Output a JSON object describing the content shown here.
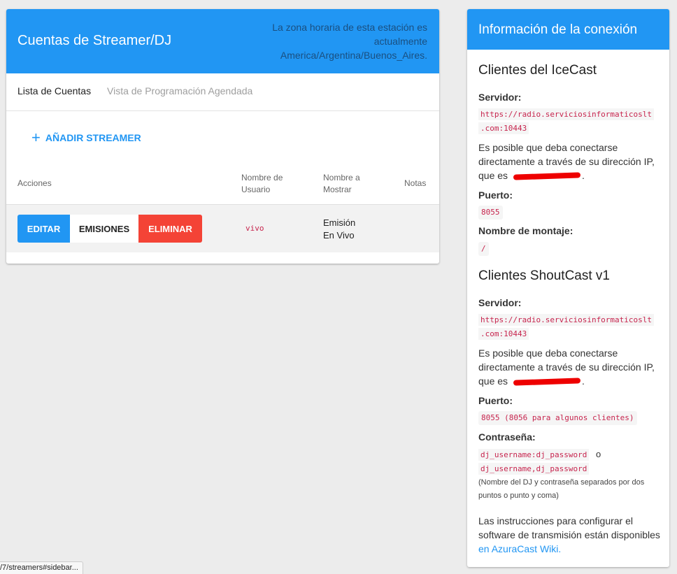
{
  "streamers": {
    "title": "Cuentas de Streamer/DJ",
    "timezone_note": "La zona horaria de esta estación es actualmente America/Argentina/Buenos_Aires.",
    "tabs": [
      "Lista de Cuentas",
      "Vista de Programación Agendada"
    ],
    "add_label": "AÑADIR STREAMER",
    "columns": {
      "actions": "Acciones",
      "username": "Nombre de Usuario",
      "display": "Nombre a Mostrar",
      "notes": "Notas"
    },
    "row": {
      "edit": "EDITAR",
      "broadcasts": "EMISIONES",
      "delete": "ELIMINAR",
      "username": "vivo",
      "display_line1": "Emisión",
      "display_line2": "En Vivo"
    }
  },
  "connection": {
    "title": "Información de la conexión",
    "icecast": {
      "title": "Clientes del IceCast",
      "server_label": "Servidor:",
      "server_line1": "https://radio.serviciosinformaticoslt",
      "server_line2": ".com:10443",
      "ip_note_a": "Es posible que deba conectarse directamente a través de su dirección IP, que es",
      "ip_note_end": ".",
      "port_label": "Puerto:",
      "port": "8055",
      "mount_label": "Nombre de montaje:",
      "mount": "/"
    },
    "shoutcast": {
      "title": "Clientes ShoutCast v1",
      "server_label": "Servidor:",
      "server_line1": "https://radio.serviciosinformaticoslt",
      "server_line2": ".com:10443",
      "ip_note_a": "Es posible que deba conectarse directamente a través de su dirección IP, que es",
      "ip_note_end": ".",
      "port_label": "Puerto:",
      "port": "8055 (8056 para algunos clientes)",
      "password_label": "Contraseña:",
      "password_1": "dj_username:dj_password",
      "password_or": "o",
      "password_2": "dj_username,dj_password",
      "password_note": "(Nombre del DJ y contraseña separados por dos puntos o punto y coma)"
    },
    "instructions_text": "Las instrucciones para configurar el software de transmisión están disponibles",
    "instructions_link": "en AzuraCast Wiki."
  },
  "statusbar": {
    "url": "/7/streamers#sidebar..."
  },
  "colors": {
    "primary": "#2196f3",
    "danger": "#f44336",
    "code": "#c7254e"
  }
}
